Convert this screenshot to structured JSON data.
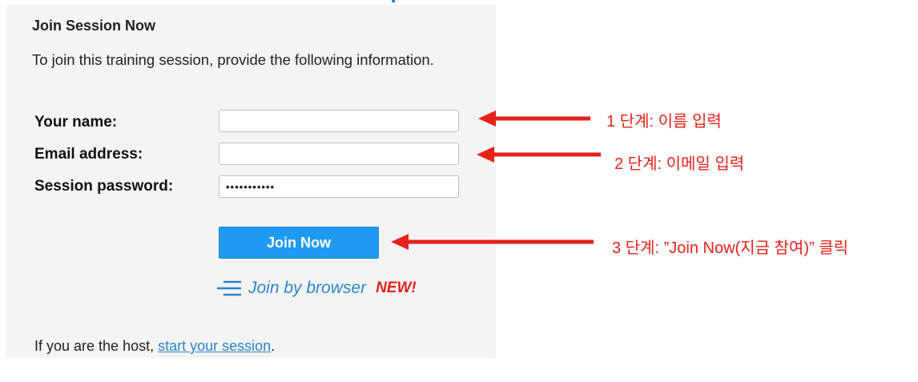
{
  "form": {
    "title": "Join Session Now",
    "intro": "To join this training session, provide the following information.",
    "fields": [
      {
        "label": "Your name:",
        "value": "",
        "placeholder": ""
      },
      {
        "label": "Email address:",
        "value": "",
        "placeholder": ""
      },
      {
        "label": "Session password:",
        "value": "•••••••••••",
        "placeholder": ""
      }
    ],
    "join_button_label": "Join Now",
    "join_browser_label": "Join by browser",
    "new_badge": "NEW!",
    "host_prefix": "If you are the host, ",
    "host_link": "start your session",
    "host_suffix": "."
  },
  "annotations": [
    {
      "text": "1 단계: 이름 입력"
    },
    {
      "text": "2 단계: 이메일 입력"
    },
    {
      "text": "3 단계: ”Join Now(지금 참여)” 클릭"
    }
  ],
  "colors": {
    "panel_background": "#f4f4f4",
    "primary_button": "#1e9bf0",
    "link": "#2a86c7",
    "annotation_red": "#e5211a"
  },
  "icons": {
    "browser": "lines-icon",
    "arrow": "red-left-arrow-icon"
  }
}
